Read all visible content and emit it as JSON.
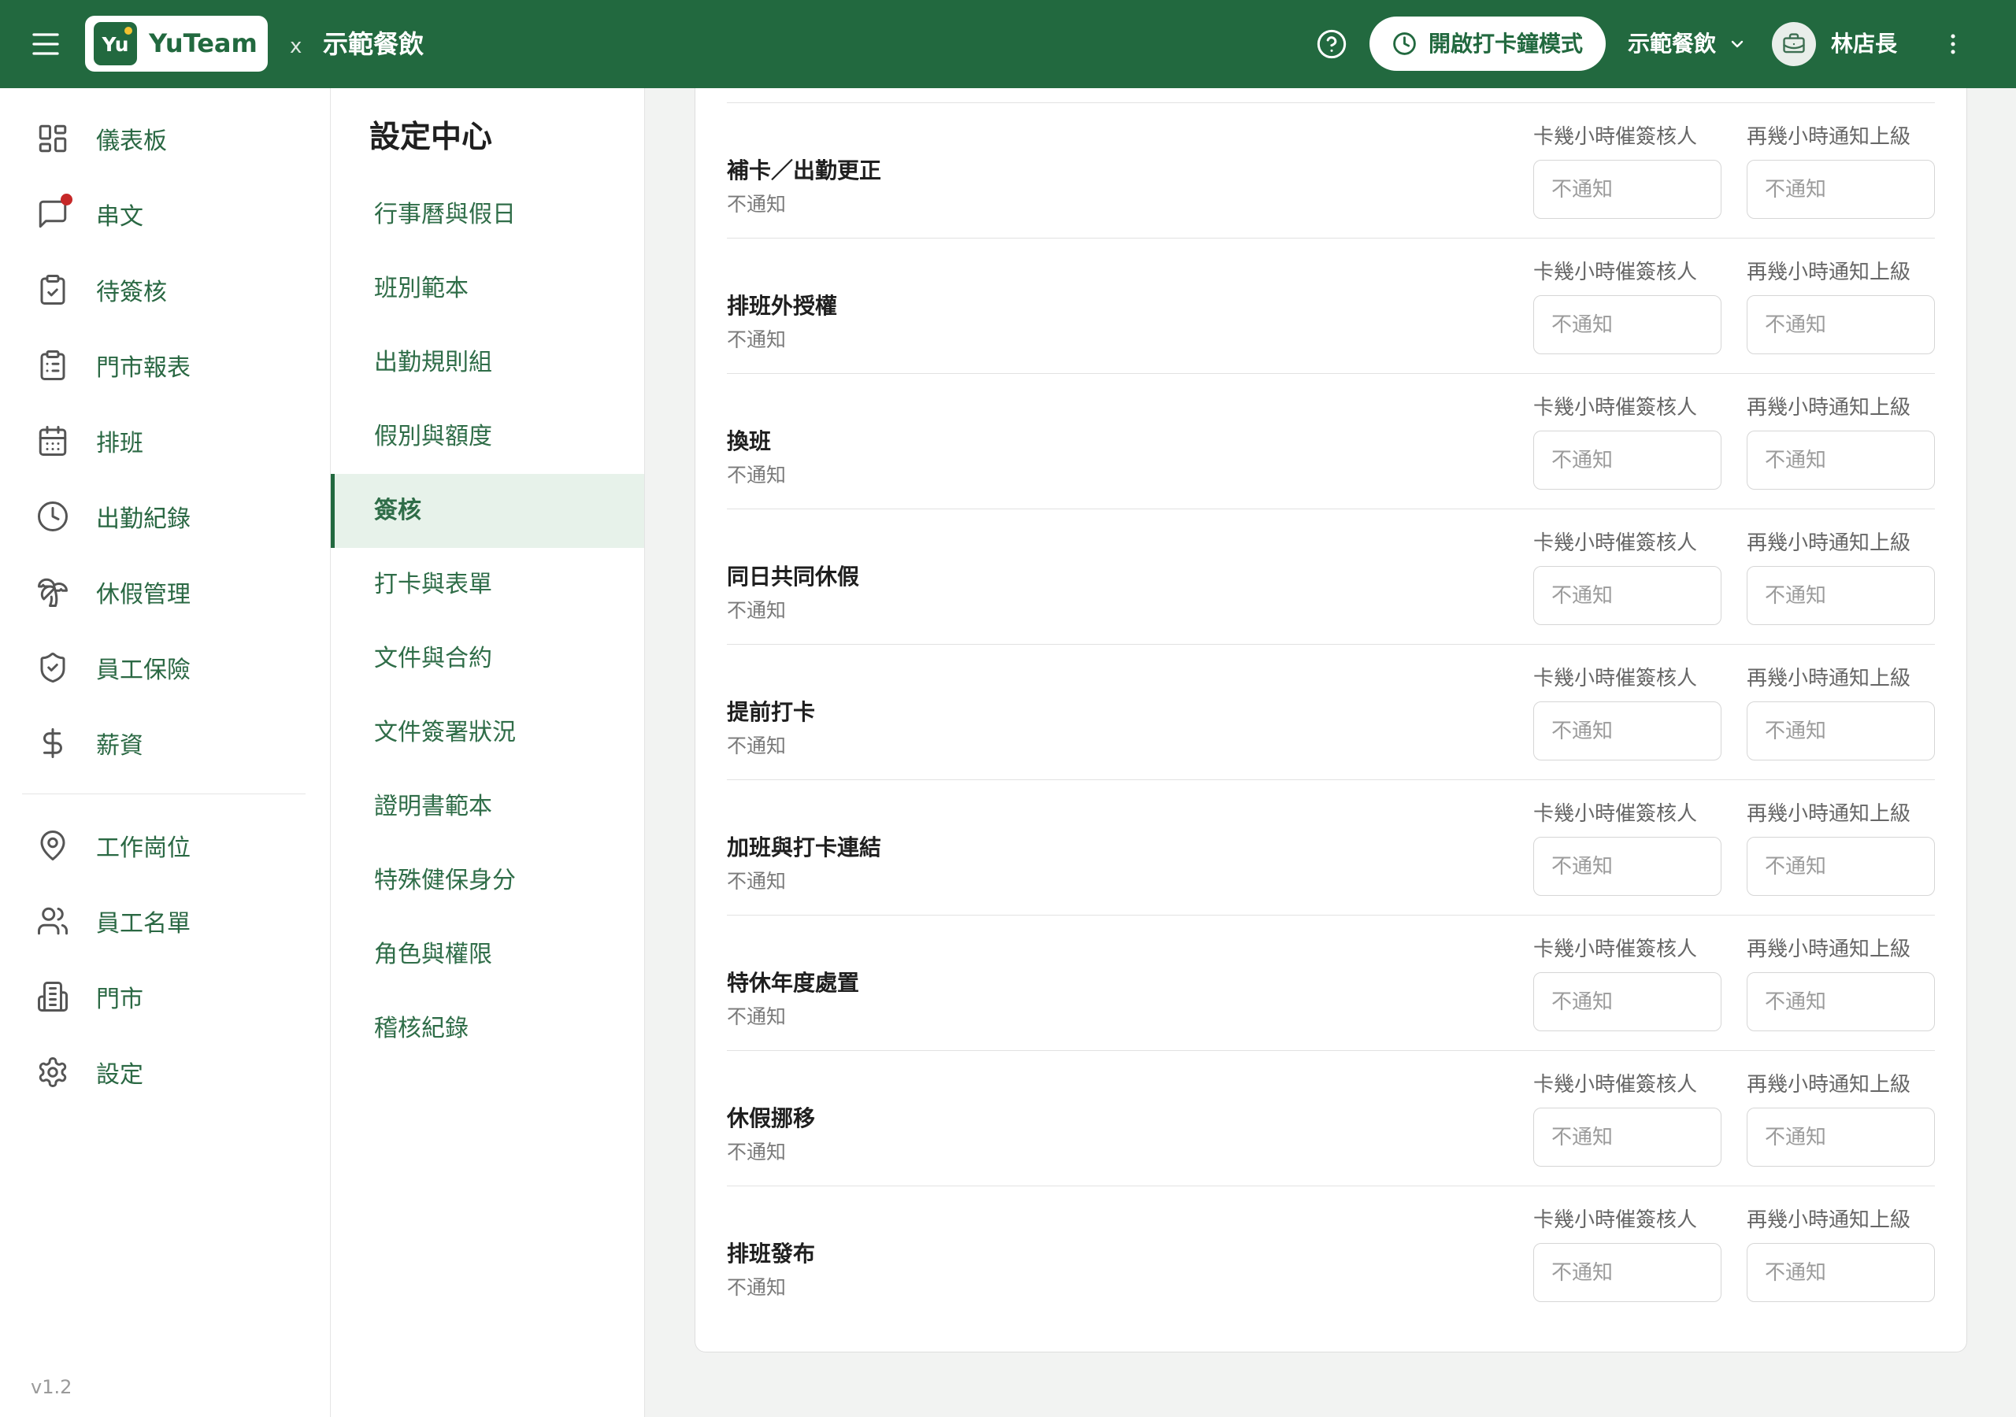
{
  "header": {
    "menu_icon": "menu-icon",
    "logo_mark": "Yu",
    "logo_text": "YuTeam",
    "separator": "x",
    "organization": "示範餐飲",
    "help_icon": "help-circle-icon",
    "clock_mode_button": "開啟打卡鐘模式",
    "clock_icon": "clock-icon",
    "org_switcher": "示範餐飲",
    "org_switcher_icon": "chevron-down-icon",
    "avatar_icon": "briefcase-icon",
    "user_name": "林店長",
    "more_icon": "more-vertical-icon"
  },
  "sidebar": {
    "primary": [
      {
        "label": "儀表板",
        "icon": "dashboard-icon"
      },
      {
        "label": "串文",
        "icon": "message-icon",
        "has_unread": true
      },
      {
        "label": "待簽核",
        "icon": "clipboard-check-icon"
      },
      {
        "label": "門市報表",
        "icon": "clipboard-list-icon"
      },
      {
        "label": "排班",
        "icon": "calendar-icon"
      },
      {
        "label": "出勤紀錄",
        "icon": "clock-icon"
      },
      {
        "label": "休假管理",
        "icon": "palm-tree-icon"
      },
      {
        "label": "員工保險",
        "icon": "shield-check-icon"
      },
      {
        "label": "薪資",
        "icon": "dollar-icon"
      }
    ],
    "secondary": [
      {
        "label": "工作崗位",
        "icon": "map-pin-icon"
      },
      {
        "label": "員工名單",
        "icon": "users-icon"
      },
      {
        "label": "門市",
        "icon": "building-icon"
      },
      {
        "label": "設定",
        "icon": "gear-icon"
      }
    ],
    "version": "v1.2"
  },
  "settings_nav": {
    "title": "設定中心",
    "items": [
      {
        "label": "行事曆與假日",
        "active": false
      },
      {
        "label": "班別範本",
        "active": false
      },
      {
        "label": "出勤規則組",
        "active": false
      },
      {
        "label": "假別與額度",
        "active": false
      },
      {
        "label": "簽核",
        "active": true
      },
      {
        "label": "打卡與表單",
        "active": false
      },
      {
        "label": "文件與合約",
        "active": false
      },
      {
        "label": "文件簽署狀況",
        "active": false
      },
      {
        "label": "證明書範本",
        "active": false
      },
      {
        "label": "特殊健保身分",
        "active": false
      },
      {
        "label": "角色與權限",
        "active": false
      },
      {
        "label": "稽核紀錄",
        "active": false
      }
    ]
  },
  "approval": {
    "remind_label": "卡幾小時催簽核人",
    "escalate_label": "再幾小時通知上級",
    "rows": [
      {
        "title": "補卡／出勤更正",
        "status": "不通知",
        "remind_placeholder": "不通知",
        "escalate_placeholder": "不通知"
      },
      {
        "title": "排班外授權",
        "status": "不通知",
        "remind_placeholder": "不通知",
        "escalate_placeholder": "不通知"
      },
      {
        "title": "換班",
        "status": "不通知",
        "remind_placeholder": "不通知",
        "escalate_placeholder": "不通知"
      },
      {
        "title": "同日共同休假",
        "status": "不通知",
        "remind_placeholder": "不通知",
        "escalate_placeholder": "不通知"
      },
      {
        "title": "提前打卡",
        "status": "不通知",
        "remind_placeholder": "不通知",
        "escalate_placeholder": "不通知"
      },
      {
        "title": "加班與打卡連結",
        "status": "不通知",
        "remind_placeholder": "不通知",
        "escalate_placeholder": "不通知"
      },
      {
        "title": "特休年度處置",
        "status": "不通知",
        "remind_placeholder": "不通知",
        "escalate_placeholder": "不通知"
      },
      {
        "title": "休假挪移",
        "status": "不通知",
        "remind_placeholder": "不通知",
        "escalate_placeholder": "不通知"
      },
      {
        "title": "排班發布",
        "status": "不通知",
        "remind_placeholder": "不通知",
        "escalate_placeholder": "不通知"
      }
    ]
  },
  "colors": {
    "primary": "#22693f",
    "active_nav_bg": "#e7f2ea",
    "unread_dot": "#c62828",
    "logo_dot": "#f2c230",
    "page_bg": "#f2f3f2"
  }
}
